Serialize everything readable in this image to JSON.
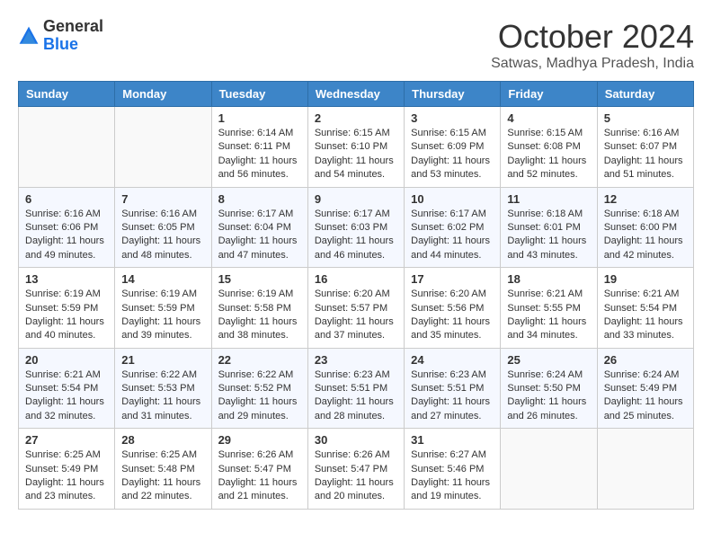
{
  "logo": {
    "general": "General",
    "blue": "Blue"
  },
  "title": "October 2024",
  "location": "Satwas, Madhya Pradesh, India",
  "days_of_week": [
    "Sunday",
    "Monday",
    "Tuesday",
    "Wednesday",
    "Thursday",
    "Friday",
    "Saturday"
  ],
  "weeks": [
    [
      {
        "day": "",
        "sunrise": "",
        "sunset": "",
        "daylight": ""
      },
      {
        "day": "",
        "sunrise": "",
        "sunset": "",
        "daylight": ""
      },
      {
        "day": "1",
        "sunrise": "Sunrise: 6:14 AM",
        "sunset": "Sunset: 6:11 PM",
        "daylight": "Daylight: 11 hours and 56 minutes."
      },
      {
        "day": "2",
        "sunrise": "Sunrise: 6:15 AM",
        "sunset": "Sunset: 6:10 PM",
        "daylight": "Daylight: 11 hours and 54 minutes."
      },
      {
        "day": "3",
        "sunrise": "Sunrise: 6:15 AM",
        "sunset": "Sunset: 6:09 PM",
        "daylight": "Daylight: 11 hours and 53 minutes."
      },
      {
        "day": "4",
        "sunrise": "Sunrise: 6:15 AM",
        "sunset": "Sunset: 6:08 PM",
        "daylight": "Daylight: 11 hours and 52 minutes."
      },
      {
        "day": "5",
        "sunrise": "Sunrise: 6:16 AM",
        "sunset": "Sunset: 6:07 PM",
        "daylight": "Daylight: 11 hours and 51 minutes."
      }
    ],
    [
      {
        "day": "6",
        "sunrise": "Sunrise: 6:16 AM",
        "sunset": "Sunset: 6:06 PM",
        "daylight": "Daylight: 11 hours and 49 minutes."
      },
      {
        "day": "7",
        "sunrise": "Sunrise: 6:16 AM",
        "sunset": "Sunset: 6:05 PM",
        "daylight": "Daylight: 11 hours and 48 minutes."
      },
      {
        "day": "8",
        "sunrise": "Sunrise: 6:17 AM",
        "sunset": "Sunset: 6:04 PM",
        "daylight": "Daylight: 11 hours and 47 minutes."
      },
      {
        "day": "9",
        "sunrise": "Sunrise: 6:17 AM",
        "sunset": "Sunset: 6:03 PM",
        "daylight": "Daylight: 11 hours and 46 minutes."
      },
      {
        "day": "10",
        "sunrise": "Sunrise: 6:17 AM",
        "sunset": "Sunset: 6:02 PM",
        "daylight": "Daylight: 11 hours and 44 minutes."
      },
      {
        "day": "11",
        "sunrise": "Sunrise: 6:18 AM",
        "sunset": "Sunset: 6:01 PM",
        "daylight": "Daylight: 11 hours and 43 minutes."
      },
      {
        "day": "12",
        "sunrise": "Sunrise: 6:18 AM",
        "sunset": "Sunset: 6:00 PM",
        "daylight": "Daylight: 11 hours and 42 minutes."
      }
    ],
    [
      {
        "day": "13",
        "sunrise": "Sunrise: 6:19 AM",
        "sunset": "Sunset: 5:59 PM",
        "daylight": "Daylight: 11 hours and 40 minutes."
      },
      {
        "day": "14",
        "sunrise": "Sunrise: 6:19 AM",
        "sunset": "Sunset: 5:59 PM",
        "daylight": "Daylight: 11 hours and 39 minutes."
      },
      {
        "day": "15",
        "sunrise": "Sunrise: 6:19 AM",
        "sunset": "Sunset: 5:58 PM",
        "daylight": "Daylight: 11 hours and 38 minutes."
      },
      {
        "day": "16",
        "sunrise": "Sunrise: 6:20 AM",
        "sunset": "Sunset: 5:57 PM",
        "daylight": "Daylight: 11 hours and 37 minutes."
      },
      {
        "day": "17",
        "sunrise": "Sunrise: 6:20 AM",
        "sunset": "Sunset: 5:56 PM",
        "daylight": "Daylight: 11 hours and 35 minutes."
      },
      {
        "day": "18",
        "sunrise": "Sunrise: 6:21 AM",
        "sunset": "Sunset: 5:55 PM",
        "daylight": "Daylight: 11 hours and 34 minutes."
      },
      {
        "day": "19",
        "sunrise": "Sunrise: 6:21 AM",
        "sunset": "Sunset: 5:54 PM",
        "daylight": "Daylight: 11 hours and 33 minutes."
      }
    ],
    [
      {
        "day": "20",
        "sunrise": "Sunrise: 6:21 AM",
        "sunset": "Sunset: 5:54 PM",
        "daylight": "Daylight: 11 hours and 32 minutes."
      },
      {
        "day": "21",
        "sunrise": "Sunrise: 6:22 AM",
        "sunset": "Sunset: 5:53 PM",
        "daylight": "Daylight: 11 hours and 31 minutes."
      },
      {
        "day": "22",
        "sunrise": "Sunrise: 6:22 AM",
        "sunset": "Sunset: 5:52 PM",
        "daylight": "Daylight: 11 hours and 29 minutes."
      },
      {
        "day": "23",
        "sunrise": "Sunrise: 6:23 AM",
        "sunset": "Sunset: 5:51 PM",
        "daylight": "Daylight: 11 hours and 28 minutes."
      },
      {
        "day": "24",
        "sunrise": "Sunrise: 6:23 AM",
        "sunset": "Sunset: 5:51 PM",
        "daylight": "Daylight: 11 hours and 27 minutes."
      },
      {
        "day": "25",
        "sunrise": "Sunrise: 6:24 AM",
        "sunset": "Sunset: 5:50 PM",
        "daylight": "Daylight: 11 hours and 26 minutes."
      },
      {
        "day": "26",
        "sunrise": "Sunrise: 6:24 AM",
        "sunset": "Sunset: 5:49 PM",
        "daylight": "Daylight: 11 hours and 25 minutes."
      }
    ],
    [
      {
        "day": "27",
        "sunrise": "Sunrise: 6:25 AM",
        "sunset": "Sunset: 5:49 PM",
        "daylight": "Daylight: 11 hours and 23 minutes."
      },
      {
        "day": "28",
        "sunrise": "Sunrise: 6:25 AM",
        "sunset": "Sunset: 5:48 PM",
        "daylight": "Daylight: 11 hours and 22 minutes."
      },
      {
        "day": "29",
        "sunrise": "Sunrise: 6:26 AM",
        "sunset": "Sunset: 5:47 PM",
        "daylight": "Daylight: 11 hours and 21 minutes."
      },
      {
        "day": "30",
        "sunrise": "Sunrise: 6:26 AM",
        "sunset": "Sunset: 5:47 PM",
        "daylight": "Daylight: 11 hours and 20 minutes."
      },
      {
        "day": "31",
        "sunrise": "Sunrise: 6:27 AM",
        "sunset": "Sunset: 5:46 PM",
        "daylight": "Daylight: 11 hours and 19 minutes."
      },
      {
        "day": "",
        "sunrise": "",
        "sunset": "",
        "daylight": ""
      },
      {
        "day": "",
        "sunrise": "",
        "sunset": "",
        "daylight": ""
      }
    ]
  ]
}
